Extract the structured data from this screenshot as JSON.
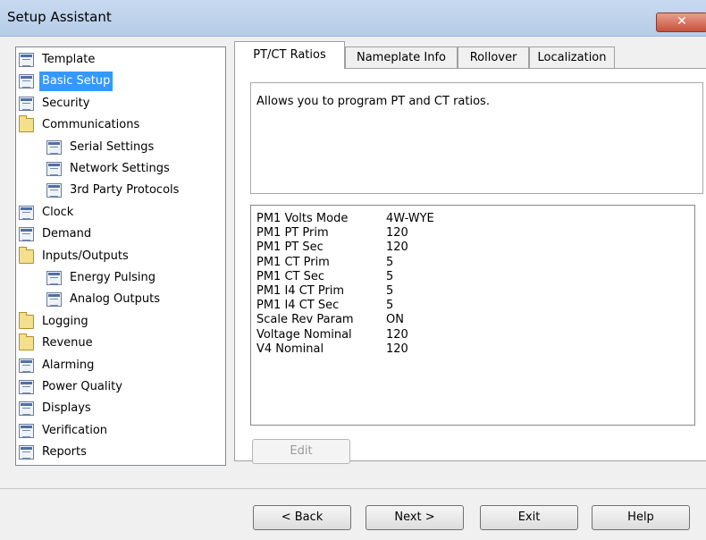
{
  "window": {
    "title": "Setup Assistant",
    "close_glyph": "✕"
  },
  "tree": {
    "items": [
      {
        "label": "Template",
        "icon": "document-icon"
      },
      {
        "label": "Basic Setup",
        "icon": "document-icon",
        "selected": true
      },
      {
        "label": "Security",
        "icon": "document-icon"
      },
      {
        "label": "Communications",
        "icon": "folder-icon"
      },
      {
        "label": "Serial Settings",
        "icon": "document-icon"
      },
      {
        "label": "Network Settings",
        "icon": "document-icon"
      },
      {
        "label": "3rd Party Protocols",
        "icon": "document-icon"
      },
      {
        "label": "Clock",
        "icon": "document-icon"
      },
      {
        "label": "Demand",
        "icon": "document-icon"
      },
      {
        "label": "Inputs/Outputs",
        "icon": "folder-icon"
      },
      {
        "label": "Energy Pulsing",
        "icon": "document-icon"
      },
      {
        "label": "Analog Outputs",
        "icon": "document-icon"
      },
      {
        "label": "Logging",
        "icon": "folder-icon"
      },
      {
        "label": "Revenue",
        "icon": "folder-icon"
      },
      {
        "label": "Alarming",
        "icon": "document-icon"
      },
      {
        "label": "Power Quality",
        "icon": "document-icon"
      },
      {
        "label": "Displays",
        "icon": "document-icon"
      },
      {
        "label": "Verification",
        "icon": "document-icon"
      },
      {
        "label": "Reports",
        "icon": "document-icon"
      }
    ]
  },
  "tabs": [
    {
      "label": "PT/CT Ratios",
      "active": true
    },
    {
      "label": "Nameplate Info"
    },
    {
      "label": "Rollover"
    },
    {
      "label": "Localization"
    }
  ],
  "description": "Allows you to program PT and CT ratios.",
  "parameters": [
    {
      "name": "PM1 Volts Mode",
      "value": "4W-WYE"
    },
    {
      "name": "PM1 PT Prim",
      "value": "120"
    },
    {
      "name": "PM1 PT Sec",
      "value": "120"
    },
    {
      "name": "PM1 CT Prim",
      "value": "5"
    },
    {
      "name": "PM1 CT Sec",
      "value": "5"
    },
    {
      "name": "PM1 I4 CT Prim",
      "value": "5"
    },
    {
      "name": "PM1 I4 CT Sec",
      "value": "5"
    },
    {
      "name": "Scale Rev Param",
      "value": "ON"
    },
    {
      "name": "Voltage Nominal",
      "value": "120"
    },
    {
      "name": "V4 Nominal",
      "value": "120"
    }
  ],
  "buttons": {
    "edit": "Edit",
    "back": "< Back",
    "next": "Next >",
    "exit": "Exit",
    "help": "Help"
  },
  "colors": {
    "selection": "#3399ff",
    "titlebar": "#c7d9ef",
    "close": "#c7503a"
  }
}
